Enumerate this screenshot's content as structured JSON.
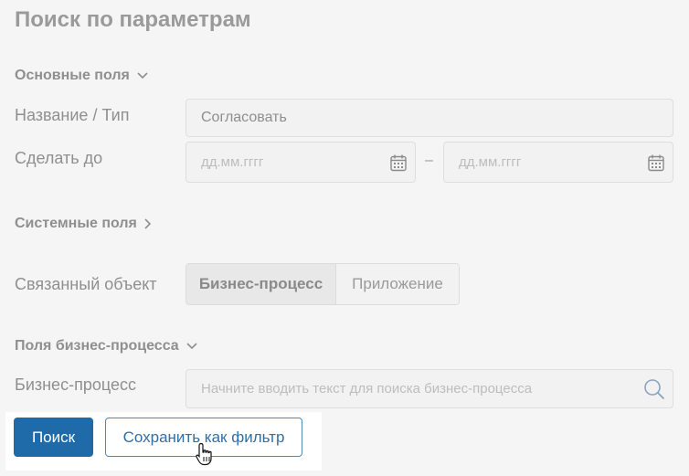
{
  "page": {
    "title": "Поиск по параметрам"
  },
  "sections": {
    "main": {
      "label": "Основные поля"
    },
    "system": {
      "label": "Системные поля"
    },
    "bp": {
      "label": "Поля бизнес-процесса"
    }
  },
  "fields": {
    "name_type": {
      "label": "Название / Тип",
      "value": "Согласовать"
    },
    "due": {
      "label": "Сделать до",
      "from_placeholder": "дд.мм.гггг",
      "to_placeholder": "дд.мм.гггг",
      "separator": "–"
    },
    "linked": {
      "label": "Связанный объект",
      "options": [
        "Бизнес-процесс",
        "Приложение"
      ],
      "selected": "Бизнес-процесс"
    },
    "bp": {
      "label": "Бизнес-процесс",
      "placeholder": "Начните вводить текст для поиска бизнес-процесса"
    }
  },
  "actions": {
    "search_label": "Поиск",
    "save_filter_label": "Сохранить как фильтр"
  },
  "colors": {
    "primary": "#1f6aa8",
    "background": "#f5f5f5",
    "outline": "#4c88bd"
  }
}
